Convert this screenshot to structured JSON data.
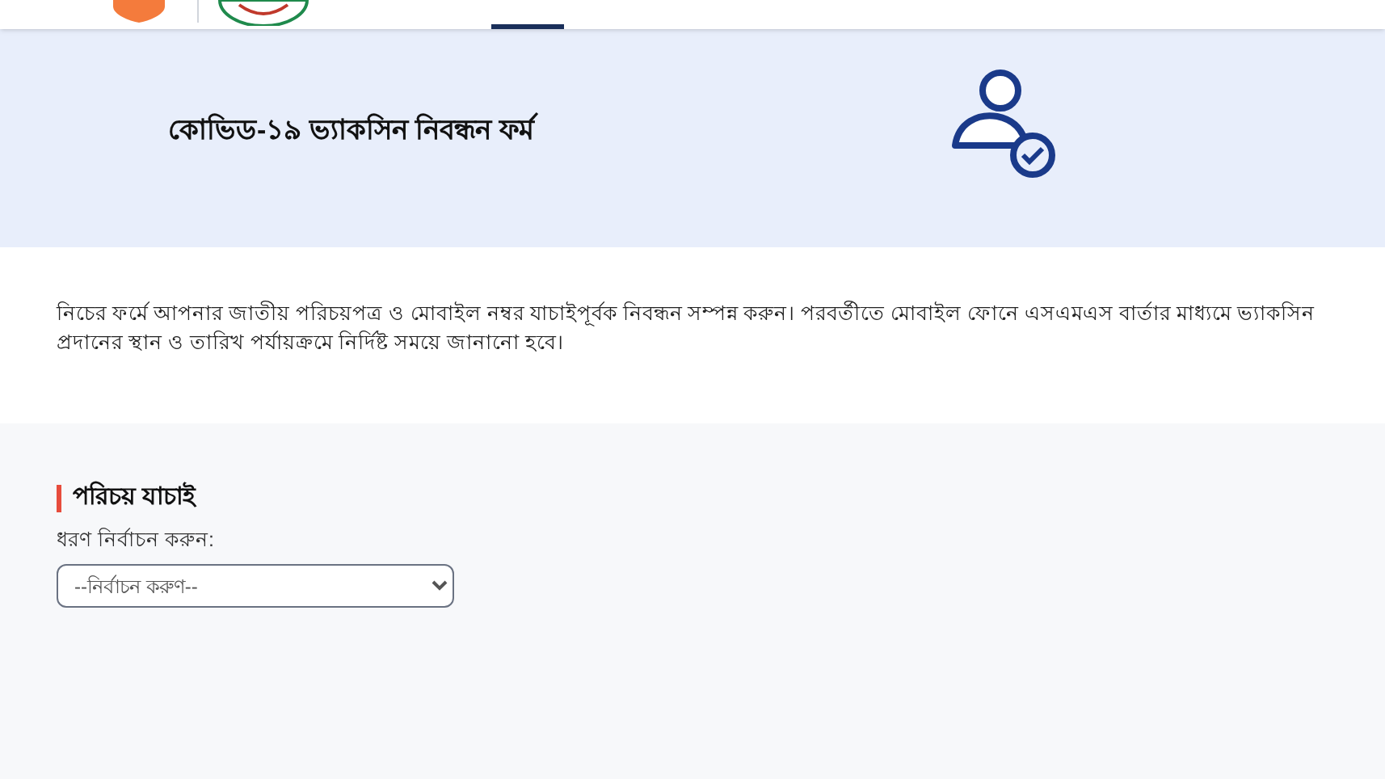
{
  "header": {
    "nav_tabs": [
      {
        "selected": true
      }
    ]
  },
  "banner": {
    "title": "কোভিড-১৯ ভ্যাকসিন নিবন্ধন ফর্ম"
  },
  "intro": {
    "text": "নিচের ফর্মে আপনার জাতীয় পরিচয়পত্র ও মোবাইল নম্বর যাচাইপূর্বক নিবন্ধন সম্পন্ন করুন। পরবর্তীতে মোবাইল ফোনে এসএমএস বার্তার মাধ্যমে ভ্যাকসিন প্রদানের স্থান ও তারিখ পর্যায়ক্রমে নির্দিষ্ট সময়ে জানানো হবে।"
  },
  "form": {
    "section_title": "পরিচয় যাচাই",
    "type_label": "ধরণ নির্বাচন করুন:",
    "type_select": {
      "placeholder": "--নির্বাচন করুণ--"
    }
  }
}
